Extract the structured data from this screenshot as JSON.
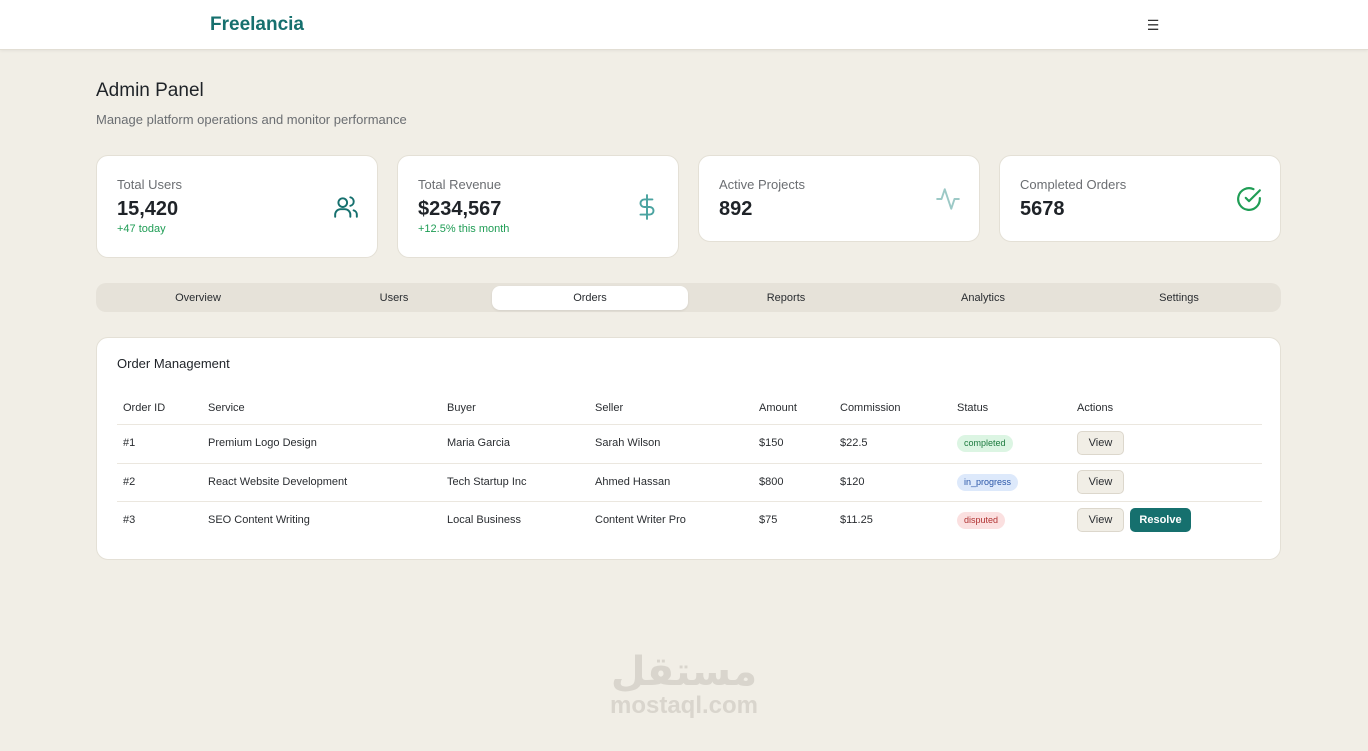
{
  "app": {
    "brand": "Freelancia",
    "menu_icon": "☰"
  },
  "header": {
    "title": "Admin Panel",
    "subtitle": "Manage platform operations and monitor performance"
  },
  "stats": [
    {
      "label": "Total Users",
      "value": "15,420",
      "sub": "+47 today",
      "icon": "users-icon"
    },
    {
      "label": "Total Revenue",
      "value": "$234,567",
      "sub": "+12.5% this month",
      "icon": "dollar-icon"
    },
    {
      "label": "Active Projects",
      "value": "892",
      "sub": "",
      "icon": "activity-icon"
    },
    {
      "label": "Completed Orders",
      "value": "5678",
      "sub": "",
      "icon": "check-circle-icon"
    }
  ],
  "tabs": [
    {
      "label": "Overview"
    },
    {
      "label": "Users"
    },
    {
      "label": "Orders"
    },
    {
      "label": "Reports"
    },
    {
      "label": "Analytics"
    },
    {
      "label": "Settings"
    }
  ],
  "active_tab": "Orders",
  "orders": {
    "title": "Order Management",
    "columns": [
      "Order ID",
      "Service",
      "Buyer",
      "Seller",
      "Amount",
      "Commission",
      "Status",
      "Actions"
    ],
    "rows": [
      {
        "id": "#1",
        "service": "Premium Logo Design",
        "buyer": "Maria Garcia",
        "seller": "Sarah Wilson",
        "amount": "$150",
        "commission": "$22.5",
        "status": "completed",
        "view": "View"
      },
      {
        "id": "#2",
        "service": "React Website Development",
        "buyer": "Tech Startup Inc",
        "seller": "Ahmed Hassan",
        "amount": "$800",
        "commission": "$120",
        "status": "in_progress",
        "view": "View"
      },
      {
        "id": "#3",
        "service": "SEO Content Writing",
        "buyer": "Local Business",
        "seller": "Content Writer Pro",
        "amount": "$75",
        "commission": "$11.25",
        "status": "disputed",
        "view": "View",
        "resolve": "Resolve"
      }
    ]
  },
  "watermark": {
    "arabic": "مستقل",
    "latin": "mostaql.com"
  },
  "colors": {
    "brand": "#16706e",
    "background": "#f1eee6",
    "positive": "#1f9d55",
    "check_icon": "#1f9d55"
  }
}
